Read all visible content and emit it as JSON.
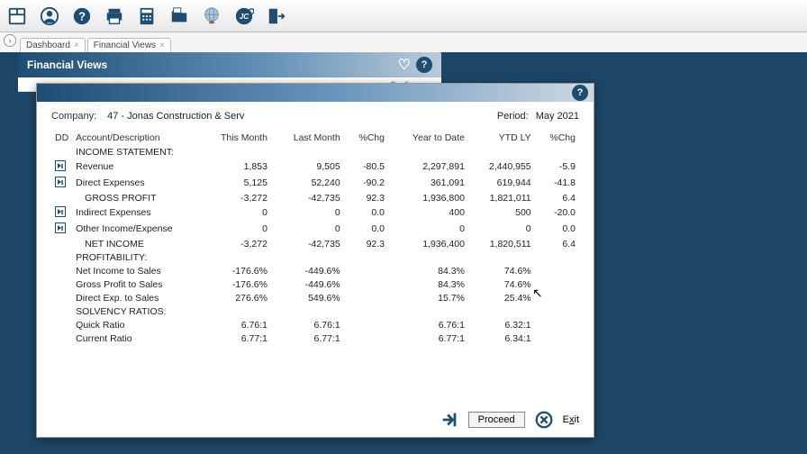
{
  "tabs": {
    "dashboard": "Dashboard",
    "financial": "Financial Views"
  },
  "panelTitle": "Financial Views",
  "subStrip": "» Configure",
  "company": {
    "label": "Company:",
    "value": "47 - Jonas Construction & Serv"
  },
  "period": {
    "label": "Period:",
    "value": "May 2021"
  },
  "columns": {
    "dd": "DD",
    "acct": "Account/Description",
    "tm": "This Month",
    "lm": "Last Month",
    "chg": "%Chg",
    "ytd": "Year to Date",
    "ytdly": "YTD LY",
    "chg2": "%Chg"
  },
  "sections": {
    "income": "INCOME STATEMENT:",
    "profit": "PROFITABILITY:",
    "solv": "SOLVENCY RATIOS:"
  },
  "income": [
    {
      "dd": true,
      "label": "Revenue",
      "tm": "1,853",
      "lm": "9,505",
      "chg": "-80.5",
      "ytd": "2,297,891",
      "ytdly": "2,440,955",
      "chg2": "-5.9"
    },
    {
      "dd": true,
      "label": "Direct Expenses",
      "tm": "5,125",
      "lm": "52,240",
      "chg": "-90.2",
      "ytd": "361,091",
      "ytdly": "619,944",
      "chg2": "-41.8"
    },
    {
      "dd": false,
      "label": "GROSS PROFIT",
      "indent": true,
      "tm": "-3,272",
      "lm": "-42,735",
      "chg": "92.3",
      "ytd": "1,936,800",
      "ytdly": "1,821,011",
      "chg2": "6.4"
    },
    {
      "dd": true,
      "label": "Indirect Expenses",
      "tm": "0",
      "lm": "0",
      "chg": "0.0",
      "ytd": "400",
      "ytdly": "500",
      "chg2": "-20.0"
    },
    {
      "dd": true,
      "label": "Other Income/Expense",
      "tm": "0",
      "lm": "0",
      "chg": "0.0",
      "ytd": "0",
      "ytdly": "0",
      "chg2": "0.0"
    },
    {
      "dd": false,
      "label": "NET INCOME",
      "indent": true,
      "tm": "-3,272",
      "lm": "-42,735",
      "chg": "92.3",
      "ytd": "1,936,400",
      "ytdly": "1,820,511",
      "chg2": "6.4"
    }
  ],
  "profitability": [
    {
      "label": "Net Income to Sales",
      "tm": "-176.6%",
      "lm": "-449.6%",
      "ytd": "84.3%",
      "ytdly": "74.6%"
    },
    {
      "label": "Gross Profit to Sales",
      "tm": "-176.6%",
      "lm": "-449.6%",
      "ytd": "84.3%",
      "ytdly": "74.6%"
    },
    {
      "label": "Direct Exp. to Sales",
      "tm": "276.6%",
      "lm": "549.6%",
      "ytd": "15.7%",
      "ytdly": "25.4%"
    }
  ],
  "solvency": [
    {
      "label": "Quick Ratio",
      "tm": "6.76:1",
      "lm": "6.76:1",
      "ytd": "6.76:1",
      "ytdly": "6.32:1"
    },
    {
      "label": "Current Ratio",
      "tm": "6.77:1",
      "lm": "6.77:1",
      "ytd": "6.77:1",
      "ytdly": "6.34:1"
    }
  ],
  "footer": {
    "proceed": "Proceed",
    "exit": "Exit",
    "exitKey": "x"
  }
}
